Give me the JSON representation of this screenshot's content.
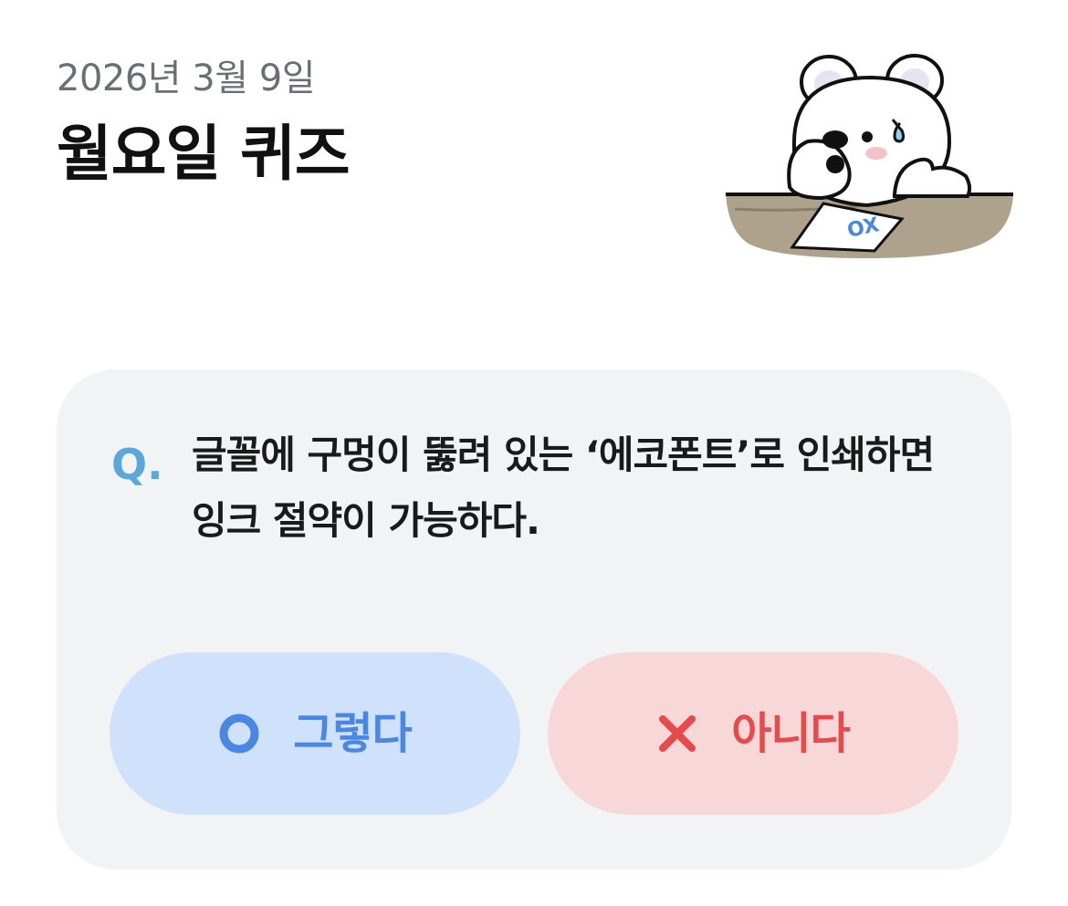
{
  "header": {
    "date": "2026년 3월 9일",
    "title": "월요일 퀴즈"
  },
  "illustration": {
    "subject": "bear-mascot",
    "paper_text": "OX"
  },
  "quiz": {
    "prefix": "Q.",
    "question": "글꼴에 구멍이 뚫려 있는 ‘에코폰트’로 인쇄하면 잉크 절약이 가능하다.",
    "answers": {
      "yes": {
        "label": "그렇다",
        "icon": "circle-o-icon",
        "color": "#4a86e4",
        "bg": "#cfe1fb"
      },
      "no": {
        "label": "아니다",
        "icon": "x-mark-icon",
        "color": "#e84a4a",
        "bg": "#f8d7d9"
      }
    }
  },
  "colors": {
    "accent_q": "#5aa7dc",
    "card_bg": "#f2f3f5"
  }
}
